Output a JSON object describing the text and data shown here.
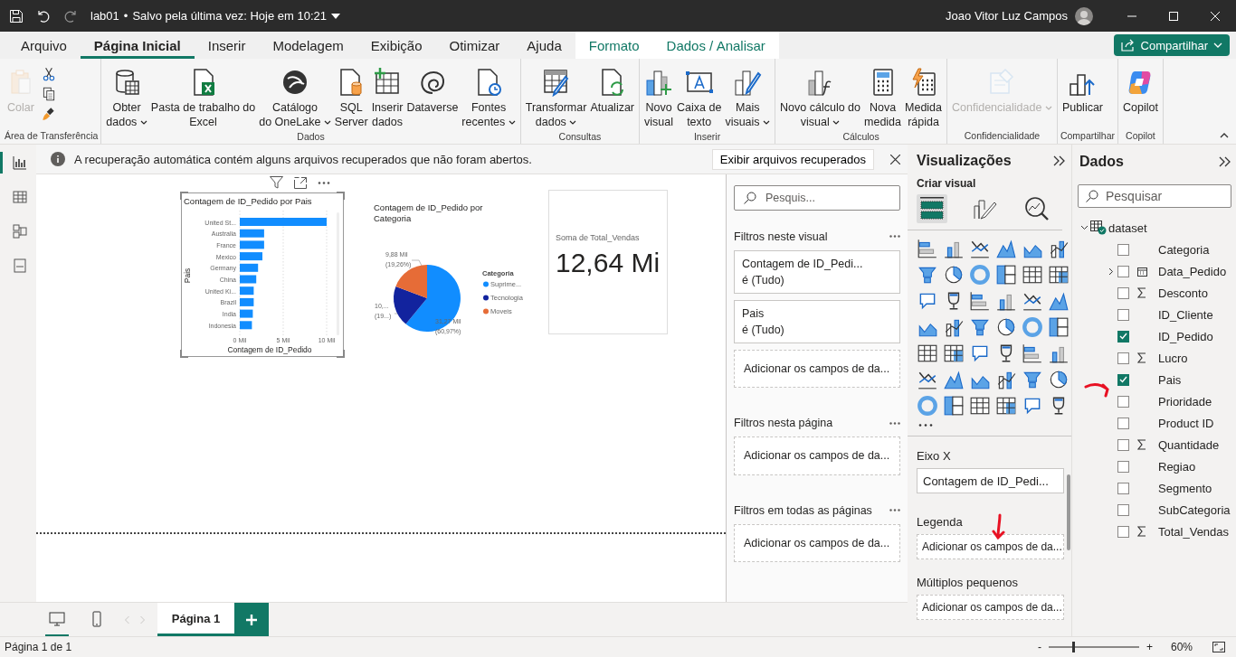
{
  "window": {
    "file_name": "lab01",
    "separator": "•",
    "save_status": "Salvo pela última vez: Hoje em 10:21",
    "user": "Joao Vitor Luz Campos"
  },
  "tabs": [
    {
      "label": "Arquivo",
      "selected": false,
      "kind": "normal"
    },
    {
      "label": "Página Inicial",
      "selected": true,
      "kind": "normal"
    },
    {
      "label": "Inserir",
      "selected": false,
      "kind": "normal"
    },
    {
      "label": "Modelagem",
      "selected": false,
      "kind": "normal"
    },
    {
      "label": "Exibição",
      "selected": false,
      "kind": "normal"
    },
    {
      "label": "Otimizar",
      "selected": false,
      "kind": "normal"
    },
    {
      "label": "Ajuda",
      "selected": false,
      "kind": "normal"
    },
    {
      "label": "Formato",
      "selected": false,
      "kind": "contextual"
    },
    {
      "label": "Dados / Analisar",
      "selected": false,
      "kind": "contextual"
    }
  ],
  "share_button": {
    "label": "Compartilhar"
  },
  "ribbon": {
    "groups": [
      {
        "label": "Área de Transferência",
        "buttons": [
          {
            "kind": "large",
            "label": "Colar",
            "disabled": true,
            "menu": false
          },
          {
            "kind": "icon"
          },
          {
            "kind": "icon"
          },
          {
            "kind": "icon"
          }
        ]
      },
      {
        "label": "Dados",
        "buttons": [
          {
            "kind": "large",
            "label": "Obter\ndados",
            "disabled": false,
            "menu": true
          },
          {
            "kind": "large",
            "label": "Pasta de trabalho do\nExcel",
            "disabled": false,
            "menu": false
          },
          {
            "kind": "large",
            "label": "Catálogo\ndo OneLake",
            "disabled": false,
            "menu": true
          },
          {
            "kind": "large",
            "label": "SQL\nServer",
            "disabled": false,
            "menu": false
          },
          {
            "kind": "large",
            "label": "Inserir\ndados",
            "disabled": false,
            "menu": false
          },
          {
            "kind": "large",
            "label": "Dataverse",
            "disabled": false,
            "menu": false
          },
          {
            "kind": "large",
            "label": "Fontes\nrecentes",
            "disabled": false,
            "menu": true
          }
        ]
      },
      {
        "label": "Consultas",
        "buttons": [
          {
            "kind": "large",
            "label": "Transformar\ndados",
            "disabled": false,
            "menu": true
          },
          {
            "kind": "large",
            "label": "Atualizar",
            "disabled": false,
            "menu": false
          }
        ]
      },
      {
        "label": "Inserir",
        "buttons": [
          {
            "kind": "large",
            "label": "Novo\nvisual",
            "disabled": false,
            "menu": false
          },
          {
            "kind": "large",
            "label": "Caixa de\ntexto",
            "disabled": false,
            "menu": false
          },
          {
            "kind": "large",
            "label": "Mais\nvisuais",
            "disabled": false,
            "menu": true
          }
        ]
      },
      {
        "label": "Cálculos",
        "buttons": [
          {
            "kind": "large",
            "label": "Novo cálculo do\nvisual",
            "disabled": false,
            "menu": true
          },
          {
            "kind": "large",
            "label": "Nova\nmedida",
            "disabled": false,
            "menu": false
          },
          {
            "kind": "large",
            "label": "Medida\nrápida",
            "disabled": false,
            "menu": false
          }
        ]
      },
      {
        "label": "Confidencialidade",
        "buttons": [
          {
            "kind": "large",
            "label": "Confidencialidade",
            "disabled": true,
            "menu": true
          }
        ]
      },
      {
        "label": "Compartilhar",
        "buttons": [
          {
            "kind": "large",
            "label": "Publicar",
            "disabled": false,
            "menu": false
          }
        ]
      },
      {
        "label": "Copilot",
        "buttons": [
          {
            "kind": "large",
            "label": "Copilot",
            "disabled": false,
            "menu": false
          }
        ]
      }
    ]
  },
  "nav": [
    {
      "selected": true
    },
    {
      "selected": false
    },
    {
      "selected": false
    },
    {
      "selected": false
    }
  ],
  "notification": {
    "message": "A recuperação automática contém alguns arquivos recuperados que não foram abertos.",
    "action": "Exibir arquivos recuperados"
  },
  "report": {
    "bar_visual": {
      "selected": true,
      "chart_data": {
        "type": "bar",
        "orientation": "horizontal",
        "title": "Contagem de ID_Pedido por Pais",
        "xlabel": "Contagem de ID_Pedido",
        "ylabel": "Pais",
        "categories": [
          "United St...",
          "Australia",
          "France",
          "Mexico",
          "Germany",
          "China",
          "United Ki...",
          "Brazil",
          "India",
          "Indonesia"
        ],
        "series": [
          {
            "color": "#118dff",
            "values": [
              10.0,
              2.8,
              2.8,
              2.6,
              2.1,
              1.9,
              1.6,
              1.6,
              1.5,
              1.4
            ]
          }
        ],
        "xlim": [
          0,
          10
        ],
        "xticks": [
          {
            "value": 0,
            "label": "0 Mil"
          },
          {
            "value": 5,
            "label": "5 Mil"
          },
          {
            "value": 10,
            "label": "10 Mil"
          }
        ]
      }
    },
    "pie_visual": {
      "chart_data": {
        "type": "pie",
        "title": "Contagem de ID_Pedido por Categoria",
        "categories": [
          "Suprime...",
          "Tecnologia",
          "Moveis"
        ],
        "series": [
          {
            "values": [
              60.97,
              19.77,
              19.26
            ]
          }
        ],
        "value_labels": [
          [
            "31,27 Mil",
            "(60,97%)"
          ],
          [
            "10,...",
            "(19...)"
          ],
          [
            "9,88 Mil",
            "(19,26%)"
          ]
        ],
        "legend": {
          "title": "Categoria",
          "colors": [
            "#118dff",
            "#12239e",
            "#e66c37"
          ]
        }
      }
    },
    "card_visual": {
      "label": "Soma de Total_Vendas",
      "value": "12,64 Mi"
    }
  },
  "filters": {
    "search": {
      "placeholder": "Pesquis..."
    },
    "sections": [
      {
        "title": "Filtros neste visual",
        "cards": [
          {
            "field": "Contagem de ID_Pedi...",
            "state": "é (Tudo)"
          },
          {
            "field": "Pais",
            "state": "é (Tudo)"
          }
        ],
        "add": "Adicionar os campos de da..."
      },
      {
        "title": "Filtros nesta página",
        "add": "Adicionar os campos de da..."
      },
      {
        "title": "Filtros em todas as páginas",
        "add": "Adicionar os campos de da..."
      }
    ]
  },
  "visualizations": {
    "title": "Visualizações",
    "subtitle": "Criar visual",
    "build_tabs": [
      {
        "selected": true
      },
      {
        "selected": false
      },
      {
        "selected": false
      }
    ],
    "wells": [
      {
        "title": "Eixo X",
        "field": "Contagem de ID_Pedi..."
      },
      {
        "title": "Legenda",
        "add": "Adicionar os campos de da..."
      },
      {
        "title": "Múltiplos pequenos",
        "add": "Adicionar os campos de da..."
      }
    ]
  },
  "data_pane": {
    "title": "Dados",
    "search": {
      "placeholder": "Pesquisar"
    },
    "tree": [
      {
        "label": "dataset",
        "kind": "table",
        "expanded": true,
        "children": [
          {
            "label": "Categoria",
            "kind": "field",
            "checked": false
          },
          {
            "label": "Data_Pedido",
            "kind": "date",
            "checked": false,
            "expanded": false
          },
          {
            "label": "Desconto",
            "kind": "sum",
            "checked": false
          },
          {
            "label": "ID_Cliente",
            "kind": "field",
            "checked": false
          },
          {
            "label": "ID_Pedido",
            "kind": "field",
            "checked": true
          },
          {
            "label": "Lucro",
            "kind": "sum",
            "checked": false
          },
          {
            "label": "Pais",
            "kind": "field",
            "checked": true
          },
          {
            "label": "Prioridade",
            "kind": "field",
            "checked": false
          },
          {
            "label": "Product ID",
            "kind": "field",
            "checked": false
          },
          {
            "label": "Quantidade",
            "kind": "sum",
            "checked": false
          },
          {
            "label": "Regiao",
            "kind": "field",
            "checked": false
          },
          {
            "label": "Segmento",
            "kind": "field",
            "checked": false
          },
          {
            "label": "SubCategoria",
            "kind": "field",
            "checked": false
          },
          {
            "label": "Total_Vendas",
            "kind": "sum",
            "checked": false
          }
        ]
      }
    ]
  },
  "views": [
    {
      "selected": true
    },
    {
      "selected": false
    }
  ],
  "pages": [
    {
      "label": "Página 1",
      "selected": true
    }
  ],
  "status_bar": {
    "page_info": "Página 1 de 1",
    "zoom_out": "-",
    "zoom_in": "+",
    "zoom": "60%",
    "zoom_level": {
      "level": 0.27
    }
  }
}
